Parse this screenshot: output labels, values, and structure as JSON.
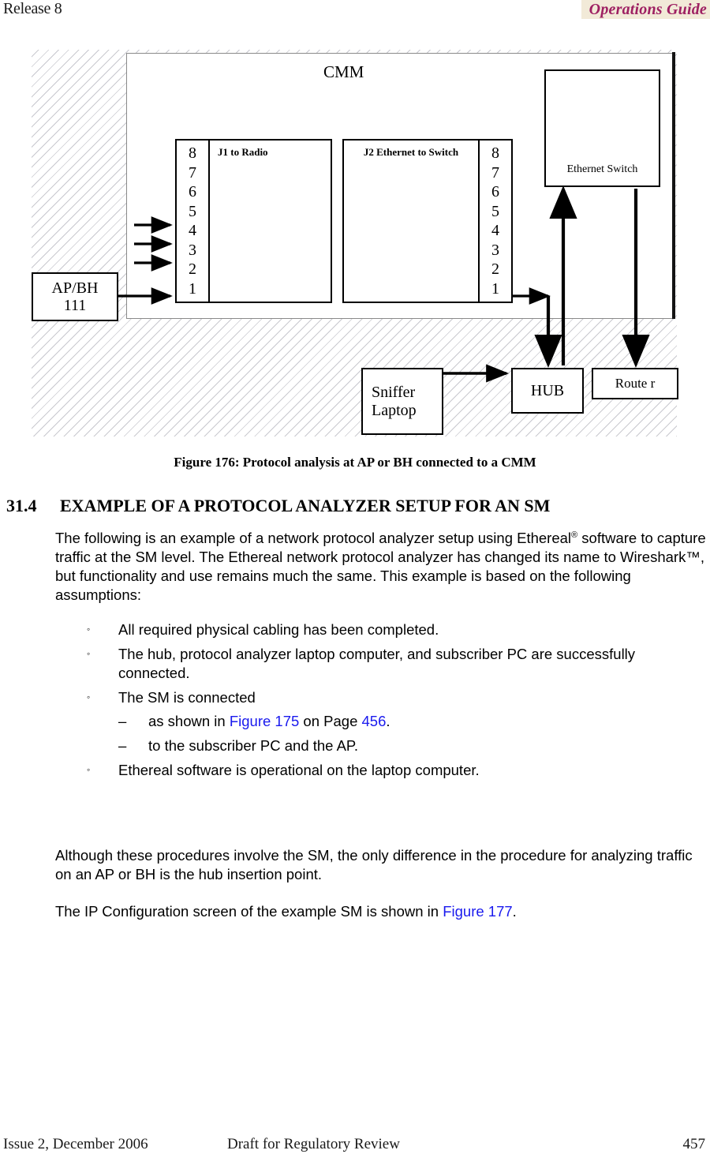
{
  "header": {
    "left": "Release 8",
    "right": "Operations Guide",
    "accent_color": "#9e2062",
    "accent_bg": "#f2ead8"
  },
  "figure": {
    "cmm_label": "CMM",
    "j1": {
      "label": "J1 to Radio",
      "pins": [
        "8",
        "7",
        "6",
        "5",
        "4",
        "3",
        "2",
        "1"
      ]
    },
    "j2": {
      "label": "J2 Ethernet to Switch",
      "pins": [
        "8",
        "7",
        "6",
        "5",
        "4",
        "3",
        "2",
        "1"
      ]
    },
    "ethernet_switch": "Ethernet Switch",
    "apbh": {
      "line1": "AP/BH",
      "line2": "111"
    },
    "sniffer": {
      "line1": "Sniffer",
      "line2": "Laptop"
    },
    "hub": "HUB",
    "router": "Route r",
    "caption": "Figure 176: Protocol analysis at AP or BH connected to a CMM"
  },
  "section": {
    "number": "31.4",
    "title": "EXAMPLE OF A PROTOCOL ANALYZER SETUP FOR AN SM"
  },
  "intro": {
    "part1": "The following is an example of a network protocol analyzer setup using Ethereal",
    "reg": "®",
    "part2": " software to capture traffic at the SM level. The Ethereal network protocol analyzer has changed its name to Wireshark™, but functionality and use remains much the same. This example is based on the following assumptions:"
  },
  "bullets": {
    "marker": "◦",
    "sub_marker": "–",
    "items": [
      {
        "text": "All required physical cabling has been completed."
      },
      {
        "text": "The hub, protocol analyzer laptop computer, and subscriber PC are successfully connected."
      },
      {
        "text": "The SM is connected",
        "subs": [
          {
            "pre": "as shown in ",
            "link1": "Figure 175",
            "mid": " on Page ",
            "link2": "456",
            "post": "."
          },
          {
            "pre": "to the subscriber PC and the AP.",
            "link1": "",
            "mid": "",
            "link2": "",
            "post": ""
          }
        ]
      },
      {
        "text": "Ethereal software is operational on the laptop computer."
      }
    ]
  },
  "tail": {
    "para1": "Although these procedures involve the SM, the only difference in the procedure for analyzing traffic on an AP or BH is the hub insertion point.",
    "para2_pre": "The IP Configuration screen of the example SM is shown in ",
    "para2_link": "Figure 177",
    "para2_post": "."
  },
  "footer": {
    "left": "Issue 2, December 2006",
    "center": "Draft for Regulatory Review",
    "right": "457"
  },
  "link_color": "#1a1aee"
}
